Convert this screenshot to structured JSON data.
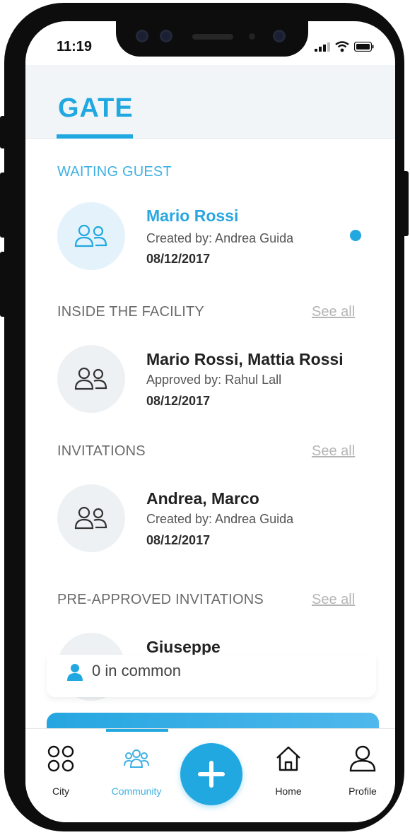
{
  "status": {
    "time": "11:19"
  },
  "header": {
    "title": "GATE"
  },
  "sections": {
    "waiting": {
      "title": "WAITING GUEST",
      "item": {
        "title": "Mario Rossi",
        "subtitle": "Created by: Andrea Guida",
        "date": "08/12/2017"
      }
    },
    "inside": {
      "title": "INSIDE THE FACILITY",
      "see_all": "See all",
      "item": {
        "title": "Mario Rossi, Mattia Rossi",
        "subtitle": "Approved by: Rahul Lall",
        "date": "08/12/2017"
      }
    },
    "invitations": {
      "title": "INVITATIONS",
      "see_all": "See all",
      "item": {
        "title": "Andrea, Marco",
        "subtitle": "Created by: Andrea Guida",
        "date": "08/12/2017"
      }
    },
    "preapproved": {
      "title": "PRE-APPROVED INVITATIONS",
      "see_all": "See all",
      "item": {
        "title": "Giuseppe"
      }
    }
  },
  "overlay_card": {
    "common_text": "0 in common"
  },
  "tabbar": {
    "city": "City",
    "community": "Community",
    "home": "Home",
    "profile": "Profile",
    "active": "community"
  },
  "colors": {
    "accent": "#21a8e1",
    "frame": "#0d0d0d",
    "header_bg": "#f1f5f7"
  }
}
